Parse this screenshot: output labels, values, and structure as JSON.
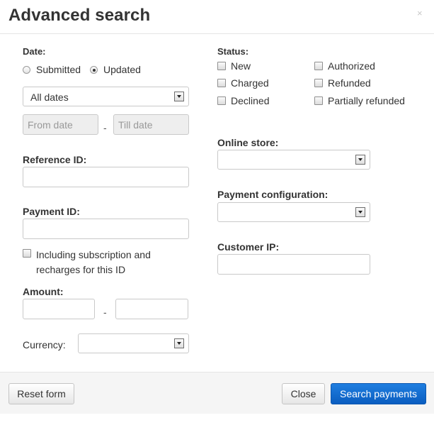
{
  "modal": {
    "title": "Advanced search",
    "close_glyph": "×"
  },
  "date": {
    "label": "Date:",
    "radio_submitted": "Submitted",
    "radio_updated": "Updated",
    "selected_radio": "Updated",
    "range_select": "All dates",
    "from_placeholder": "From date",
    "till_placeholder": "Till date",
    "separator": "-"
  },
  "reference_id": {
    "label": "Reference ID:",
    "value": ""
  },
  "payment_id": {
    "label": "Payment ID:",
    "value": "",
    "include_checkbox_line1": "Including subscription and",
    "include_checkbox_line2": "recharges for this ID",
    "include_checked": false
  },
  "amount": {
    "label": "Amount:",
    "min": "",
    "max": "",
    "separator": "-"
  },
  "currency": {
    "label": "Currency:",
    "value": ""
  },
  "status": {
    "label": "Status:",
    "options": [
      {
        "label": "New",
        "checked": false
      },
      {
        "label": "Authorized",
        "checked": false
      },
      {
        "label": "Charged",
        "checked": false
      },
      {
        "label": "Refunded",
        "checked": false
      },
      {
        "label": "Declined",
        "checked": false
      },
      {
        "label": "Partially refunded",
        "checked": false
      }
    ]
  },
  "online_store": {
    "label": "Online store:",
    "value": ""
  },
  "payment_configuration": {
    "label": "Payment configuration:",
    "value": ""
  },
  "customer_ip": {
    "label": "Customer IP:",
    "value": ""
  },
  "footer": {
    "reset_label": "Reset form",
    "close_label": "Close",
    "search_label": "Search payments"
  },
  "colors": {
    "link": "#3a7ab5",
    "primary_button": "#1a73d9",
    "footer_bg": "#f5f5f5"
  },
  "icons": {
    "radio": "radio-button",
    "checkbox": "checkbox",
    "select_arrow": "chevron-down-icon",
    "close": "close-icon"
  }
}
